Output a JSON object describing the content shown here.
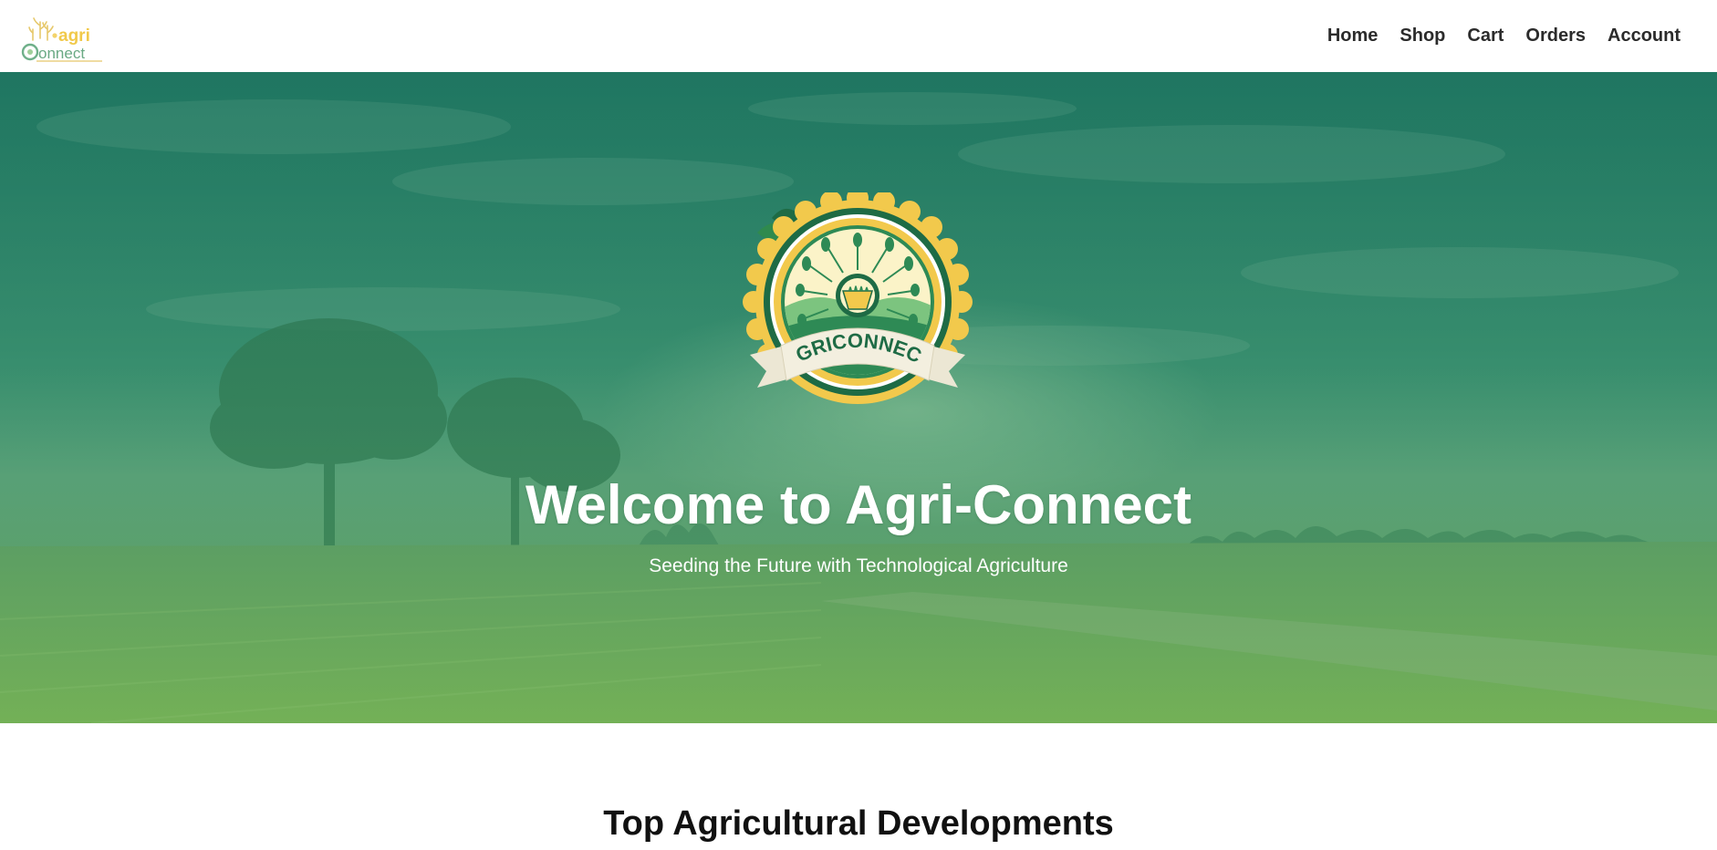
{
  "header": {
    "logo_text": "agri Connect",
    "nav": [
      {
        "label": "Home"
      },
      {
        "label": "Shop"
      },
      {
        "label": "Cart"
      },
      {
        "label": "Orders"
      },
      {
        "label": "Account"
      }
    ]
  },
  "hero": {
    "emblem_text": "AGRICONNECT",
    "title": "Welcome to Agri-Connect",
    "subtitle": "Seeding the Future with Technological Agriculture"
  },
  "sections": {
    "developments_title": "Top Agricultural Developments"
  },
  "colors": {
    "overlay_green": "#1f7a5f",
    "emblem_dark_green": "#1e6b45",
    "emblem_gold": "#f2c94c",
    "emblem_cream": "#fbf3c8",
    "nav_text": "#2b2b2b"
  }
}
